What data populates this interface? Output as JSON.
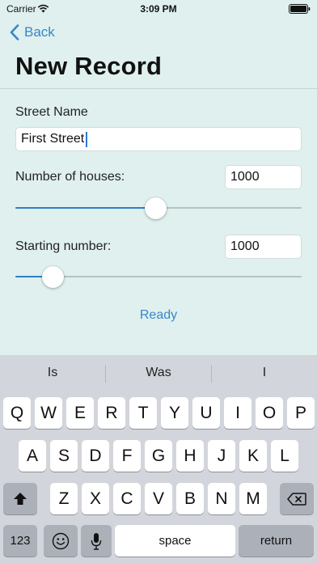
{
  "status_bar": {
    "carrier": "Carrier",
    "time": "3:09 PM"
  },
  "nav": {
    "back_label": "Back",
    "title": "New Record"
  },
  "form": {
    "street_label": "Street Name",
    "street_value": "First Street",
    "houses_label": "Number of houses:",
    "houses_value": "1000",
    "houses_slider_fraction": 0.49,
    "start_label": "Starting number:",
    "start_value": "1000",
    "start_slider_fraction": 0.13,
    "ready_label": "Ready"
  },
  "keyboard": {
    "suggestions": [
      "Is",
      "Was",
      "I"
    ],
    "row1": [
      "Q",
      "W",
      "E",
      "R",
      "T",
      "Y",
      "U",
      "I",
      "O",
      "P"
    ],
    "row2": [
      "A",
      "S",
      "D",
      "F",
      "G",
      "H",
      "J",
      "K",
      "L"
    ],
    "row3": [
      "Z",
      "X",
      "C",
      "V",
      "B",
      "N",
      "M"
    ],
    "numbers_label": "123",
    "space_label": "space",
    "return_label": "return"
  },
  "icons": [
    "wifi-icon",
    "battery-icon",
    "back-chevron-icon",
    "shift-icon",
    "backspace-icon",
    "emoji-icon",
    "microphone-icon"
  ],
  "colors": {
    "accent": "#3a86c8",
    "slider_fill": "#2e7fc2",
    "background": "#dff0ee",
    "keyboard": "#d2d5db"
  }
}
